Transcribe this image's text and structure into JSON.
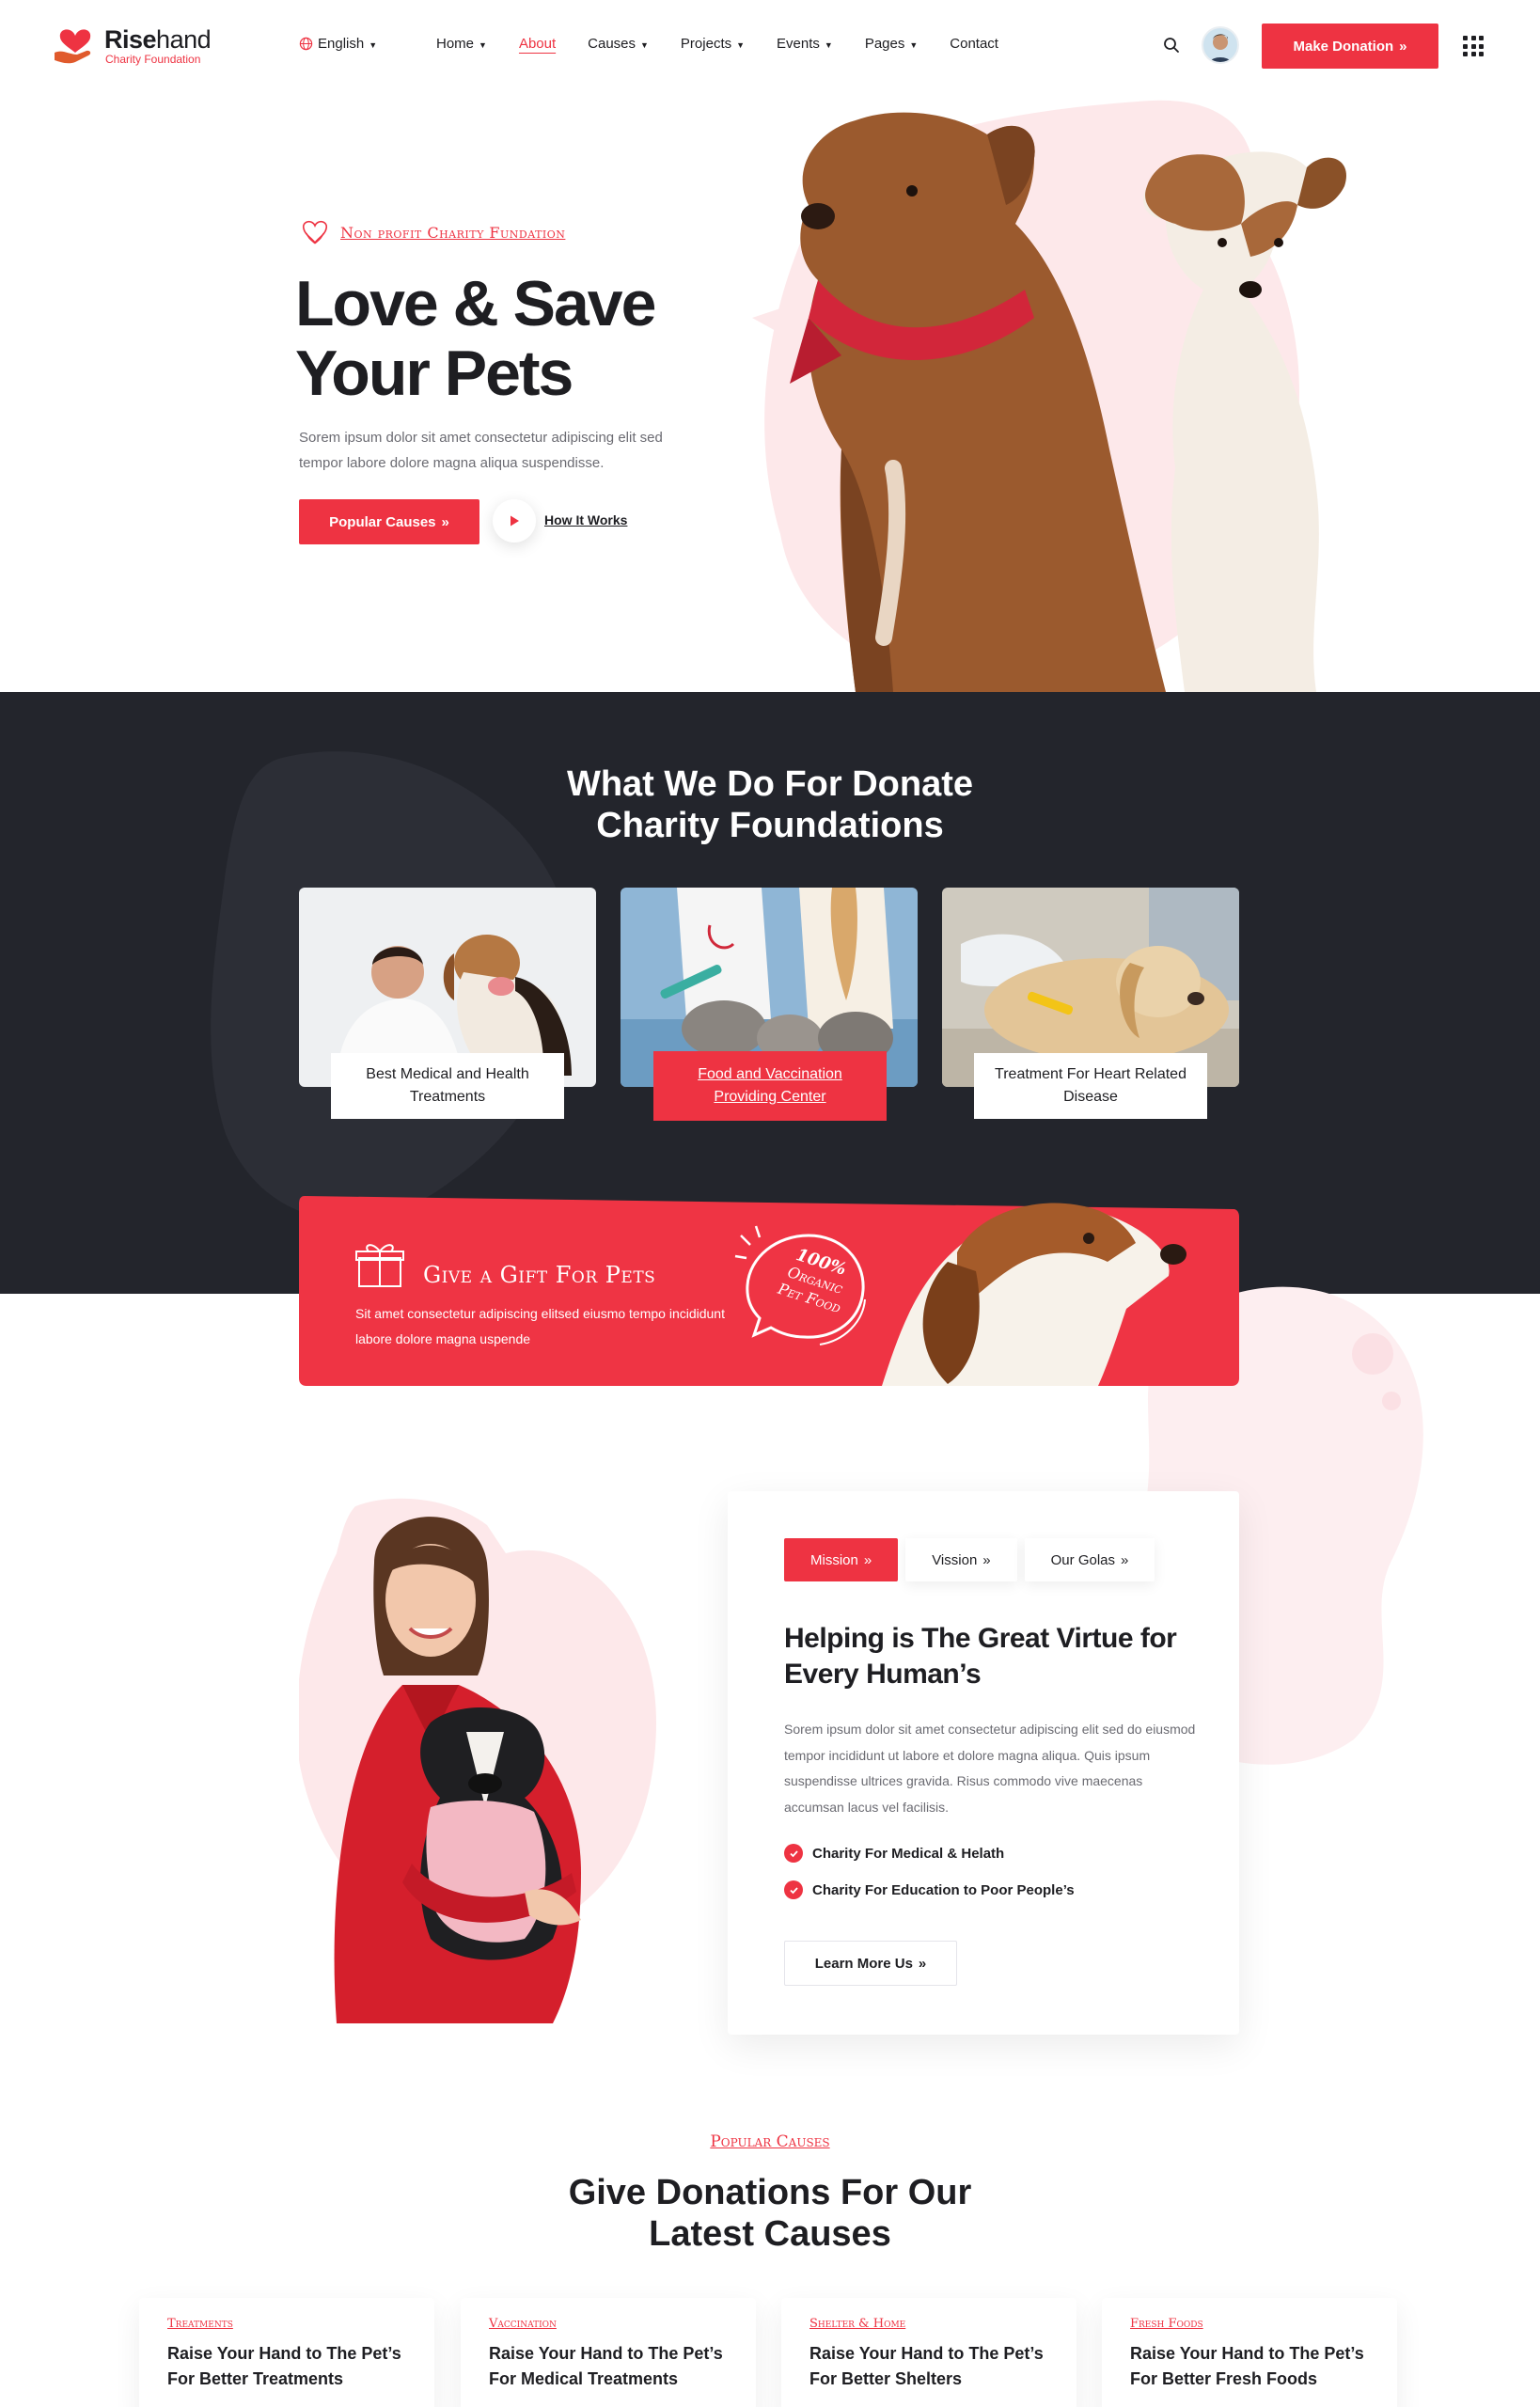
{
  "header": {
    "logo_bold": "Rise",
    "logo_light": "hand",
    "logo_sub": "Charity Foundation",
    "language": "English",
    "nav": [
      {
        "label": "Home",
        "dropdown": true
      },
      {
        "label": "About",
        "dropdown": false,
        "active": true
      },
      {
        "label": "Causes",
        "dropdown": true
      },
      {
        "label": "Projects",
        "dropdown": true
      },
      {
        "label": "Events",
        "dropdown": true
      },
      {
        "label": "Pages",
        "dropdown": true
      },
      {
        "label": "Contact",
        "dropdown": false
      }
    ],
    "donate_label": "Make Donation",
    "icons": [
      "globe-icon",
      "search-icon",
      "avatar",
      "grid-menu-icon"
    ]
  },
  "hero": {
    "tag": "Non profit Charity Fundation",
    "title_line1": "Love & Save",
    "title_line2": "Your Pets",
    "description": "Sorem ipsum dolor sit amet consectetur adipiscing elit sed tempor labore dolore magna aliqua suspendisse.",
    "primary_label": "Popular Causes",
    "video_label": "How It Works"
  },
  "what_we_do": {
    "title_line1": "What We Do For Donate",
    "title_line2": "Charity Foundations",
    "services": [
      {
        "label": "Best Medical and Health Treatments"
      },
      {
        "label": "Food and Vaccination Providing Center",
        "highlighted": true
      },
      {
        "label": "Treatment For Heart Related Disease"
      }
    ]
  },
  "gift": {
    "title": "Give a Gift For Pets",
    "description": "Sit amet consectetur adipiscing elitsed eiusmo tempo incididunt labore dolore magna uspende",
    "badge_line1": "100%",
    "badge_line2": "Organic",
    "badge_line3": "Pet Food"
  },
  "mission": {
    "tabs": [
      {
        "label": "Mission",
        "active": true
      },
      {
        "label": "Vission",
        "active": false
      },
      {
        "label": "Our Golas",
        "active": false
      }
    ],
    "title": "Helping is The Great Virtue for Every Human’s",
    "description": "Sorem ipsum dolor sit amet consectetur adipiscing elit sed do eiusmod tempor incididunt ut labore et dolore magna aliqua. Quis ipsum suspendisse ultrices gravida. Risus commodo vive maecenas accumsan lacus vel facilisis.",
    "checks": [
      "Charity For Medical & Helath",
      "Charity For Education to Poor People’s"
    ],
    "button_label": "Learn More Us"
  },
  "causes": {
    "tag": "Popular Causes",
    "title_line1": "Give Donations For Our",
    "title_line2": "Latest Causes",
    "cards": [
      {
        "category": "Treatments",
        "title": "Raise Your Hand to The Pet’s For Better Treatments"
      },
      {
        "category": "Vaccination",
        "title": "Raise Your Hand to The Pet’s For Medical Treatments"
      },
      {
        "category": "Shelter & Home",
        "title": "Raise Your Hand to The Pet’s For Better Shelters"
      },
      {
        "category": "Fresh Foods",
        "title": "Raise Your Hand to The Pet’s For Better Fresh Foods"
      }
    ]
  },
  "colors": {
    "accent": "#ee3342",
    "dark": "#23252c",
    "text": "#1e1e22",
    "muted": "#6b6b72",
    "blush": "#fde8ea"
  }
}
